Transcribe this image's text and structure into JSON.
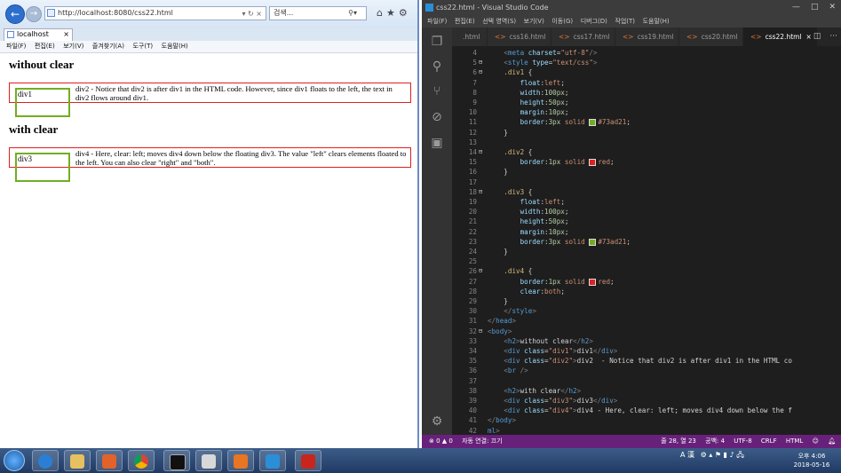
{
  "ie": {
    "address": "http://localhost:8080/css22.html",
    "search_placeholder": "검색...",
    "tab_title": "localhost",
    "menus": [
      "파일(F)",
      "편집(E)",
      "보기(V)",
      "즐겨찾기(A)",
      "도구(T)",
      "도움말(H)"
    ],
    "page": {
      "heading1": "without clear",
      "div1": "div1",
      "div2": "div2 - Notice that div2 is after div1 in the HTML code. However, since div1 floats to the left, the text in div2 flows around div1.",
      "heading2": "with clear",
      "div3": "div3",
      "div4": "div4 - Here, clear: left; moves div4 down below the floating div3. The value \"left\" clears elements floated to the left. You can also clear \"right\" and \"both\"."
    }
  },
  "vscode": {
    "title": "css22.html - Visual Studio Code",
    "menus": [
      "파일(F)",
      "편집(E)",
      "선택 영역(S)",
      "보기(V)",
      "이동(G)",
      "디버그(D)",
      "작업(T)",
      "도움말(H)"
    ],
    "tabs": [
      ".html",
      "css16.html",
      "css17.html",
      "css19.html",
      "css20.html",
      "css22.html"
    ],
    "active_tab": "css22.html",
    "line_numbers": [
      "4",
      "5",
      "6",
      "7",
      "8",
      "9",
      "10",
      "11",
      "12",
      "13",
      "14",
      "15",
      "16",
      "17",
      "18",
      "19",
      "20",
      "21",
      "22",
      "23",
      "24",
      "25",
      "26",
      "27",
      "28",
      "29",
      "30",
      "31",
      "32",
      "33",
      "34",
      "35",
      "36",
      "37",
      "38",
      "39",
      "40",
      "41",
      "42"
    ],
    "status": {
      "errors": "⊗ 0 ▲ 0",
      "auto_connect": "자동 연결: 끄기",
      "position": "줄 28, 열 23",
      "spaces": "공백: 4",
      "encoding": "UTF-8",
      "eol": "CRLF",
      "language": "HTML"
    },
    "colors": {
      "green": "#73ad21",
      "red": "#e02020",
      "statusbar": "#68217a"
    }
  },
  "taskbar": {
    "time": "오후 4:06",
    "date": "2018-05-16",
    "ime": "A 漢"
  }
}
